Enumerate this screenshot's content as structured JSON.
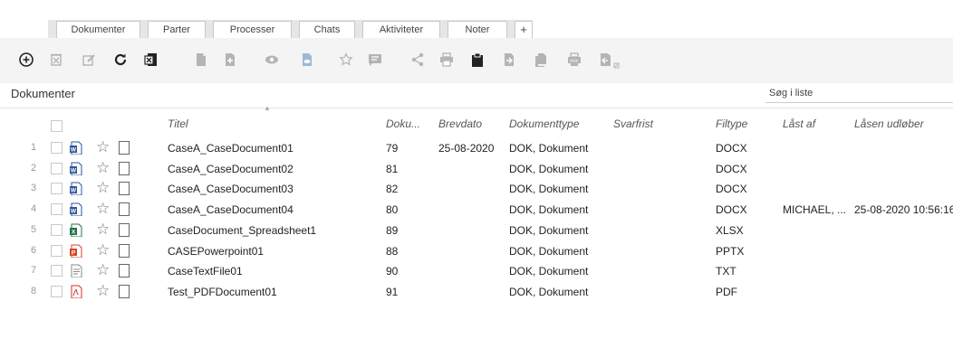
{
  "tabs": [
    "Dokumenter",
    "Parter",
    "Processer",
    "Chats",
    "Aktiviteter",
    "Noter",
    "+"
  ],
  "toolbar_icons": [
    "add-icon",
    "delete-icon",
    "edit-icon",
    "refresh-icon",
    "excel-export-icon",
    "document-icon",
    "new-document-icon",
    "view-icon",
    "preview-icon",
    "favorite-icon",
    "comment-icon",
    "share-icon",
    "print-icon",
    "clipboard-icon",
    "import-icon",
    "copy-icon",
    "pdf-icon",
    "download-icon"
  ],
  "panel_title": "Dokumenter",
  "search_placeholder": "Søg i liste",
  "columns": [
    "Titel",
    "Doku...",
    "Brevdato",
    "Dokumenttype",
    "Svarfrist",
    "Filtype",
    "Låst af",
    "Låsen udløber"
  ],
  "rows": [
    {
      "n": "1",
      "icon": "word",
      "title": "CaseA_CaseDocument01",
      "doc": "79",
      "date": "25-08-2020",
      "type": "DOK, Dokument",
      "due": "",
      "ext": "DOCX",
      "locked": "",
      "expires": ""
    },
    {
      "n": "2",
      "icon": "word",
      "title": "CaseA_CaseDocument02",
      "doc": "81",
      "date": "",
      "type": "DOK, Dokument",
      "due": "",
      "ext": "DOCX",
      "locked": "",
      "expires": ""
    },
    {
      "n": "3",
      "icon": "word",
      "title": "CaseA_CaseDocument03",
      "doc": "82",
      "date": "",
      "type": "DOK, Dokument",
      "due": "",
      "ext": "DOCX",
      "locked": "",
      "expires": ""
    },
    {
      "n": "4",
      "icon": "word",
      "title": "CaseA_CaseDocument04",
      "doc": "80",
      "date": "",
      "type": "DOK, Dokument",
      "due": "",
      "ext": "DOCX",
      "locked": "MICHAEL, ...",
      "expires": "25-08-2020 10:56:16"
    },
    {
      "n": "5",
      "icon": "excel",
      "title": "CaseDocument_Spreadsheet1",
      "doc": "89",
      "date": "",
      "type": "DOK, Dokument",
      "due": "",
      "ext": "XLSX",
      "locked": "",
      "expires": ""
    },
    {
      "n": "6",
      "icon": "powerpoint",
      "title": "CASEPowerpoint01",
      "doc": "88",
      "date": "",
      "type": "DOK, Dokument",
      "due": "",
      "ext": "PPTX",
      "locked": "",
      "expires": ""
    },
    {
      "n": "7",
      "icon": "text",
      "title": "CaseTextFile01",
      "doc": "90",
      "date": "",
      "type": "DOK, Dokument",
      "due": "",
      "ext": "TXT",
      "locked": "",
      "expires": ""
    },
    {
      "n": "8",
      "icon": "pdf",
      "title": "Test_PDFDocument01",
      "doc": "91",
      "date": "",
      "type": "DOK, Dokument",
      "due": "",
      "ext": "PDF",
      "locked": "",
      "expires": ""
    }
  ],
  "colors": {
    "word": "#2b579a",
    "excel": "#217346",
    "powerpoint": "#d24726",
    "pdf": "#d32f2f",
    "text": "#8a8a8a"
  }
}
